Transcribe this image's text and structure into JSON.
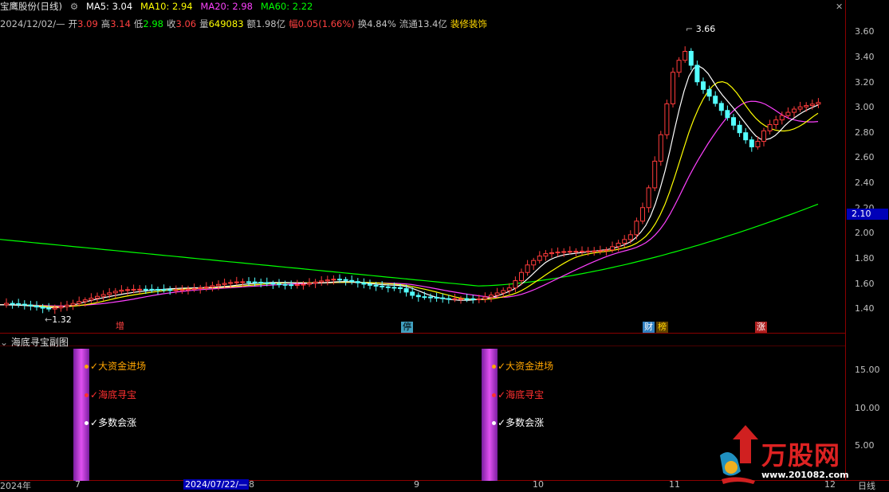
{
  "header": {
    "stock_title": "宝鹰股份(日线)",
    "ma5": "MA5: 3.04",
    "ma10": "MA10: 2.94",
    "ma20": "MA20: 2.98",
    "ma60": "MA60: 2.22",
    "colors": {
      "ma5": "#ffffff",
      "ma10": "#ffff00",
      "ma20": "#ff40ff",
      "ma60": "#00ff00"
    }
  },
  "quote": {
    "date": "2024/12/02/—",
    "open_label": "开",
    "open": "3.09",
    "high_label": "高",
    "high": "3.14",
    "low_label": "低",
    "low": "2.98",
    "close_label": "收",
    "close": "3.06",
    "volume_label": "量",
    "volume": "649083",
    "amount_label": "额",
    "amount": "1.98亿",
    "change_label": "幅",
    "change": "0.05(1.66%)",
    "turnover_label": "换",
    "turnover": "4.84%",
    "float_label": "流通",
    "float": "13.4亿",
    "sector": "装修装饰"
  },
  "price_axis": [
    "3.60",
    "3.40",
    "3.20",
    "3.00",
    "2.80",
    "2.60",
    "2.40",
    "2.20",
    "2.00",
    "1.80",
    "1.60",
    "1.40"
  ],
  "last_price_tag": "2.10",
  "annotations": {
    "high": "3.66",
    "low": "1.32"
  },
  "event_badges": [
    {
      "label": "增",
      "color": "#ff4040",
      "bg": "#000"
    },
    {
      "label": "停",
      "color": "#000",
      "bg": "#40a0c0"
    },
    {
      "label": "财",
      "color": "#fff",
      "bg": "#3080c0"
    },
    {
      "label": "榜",
      "color": "#ffd700",
      "bg": "#604000"
    },
    {
      "label": "涨",
      "color": "#fff",
      "bg": "#b02020"
    }
  ],
  "sub_chart": {
    "title": "海底寻宝副图",
    "axis": [
      "15.00",
      "10.00",
      "5.00"
    ],
    "signals": [
      "大资金进场",
      "海底寻宝",
      "多数会涨"
    ],
    "signal_colors": [
      "#ffa500",
      "#ff3030",
      "#ffffff"
    ]
  },
  "time_axis": {
    "labels": [
      "2024年",
      "7",
      "2024/07/22/—",
      "8",
      "9",
      "10",
      "11",
      "12"
    ],
    "period": "日线"
  },
  "watermark": {
    "brand": "万股网",
    "url": "www.201082.com"
  }
}
